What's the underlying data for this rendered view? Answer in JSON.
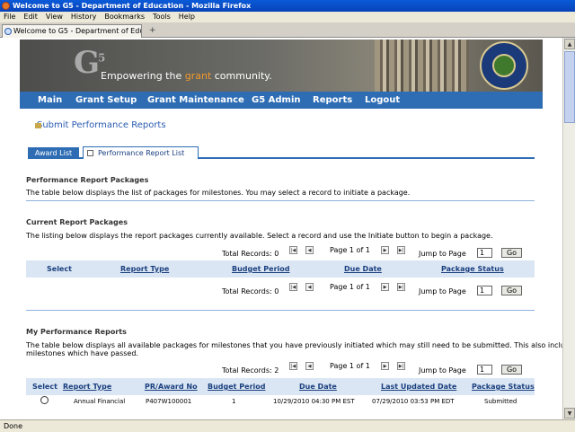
{
  "window": {
    "title": "Welcome to G5 - Department of Education - Mozilla Firefox"
  },
  "menu": [
    "File",
    "Edit",
    "View",
    "History",
    "Bookmarks",
    "Tools",
    "Help"
  ],
  "browser_tab": {
    "title": "Welcome to G5 - Department of Educ...",
    "new_tab": "+"
  },
  "status": "Done",
  "banner": {
    "logo": "G",
    "logo_sup": "5",
    "tagline_pre": "Empowering the ",
    "tagline_accent": "grant",
    "tagline_post": " community.",
    "accent": "#f39a2a"
  },
  "nav": [
    "Main",
    "Grant Setup",
    "Grant Maintenance",
    "G5 Admin",
    "Reports",
    "Logout"
  ],
  "page_title": "Submit Performance Reports",
  "tabs": {
    "award": "Award List",
    "perf": "Performance Report List"
  },
  "packages": {
    "title": "Performance Report Packages",
    "desc": "The table below displays the list of packages for milestones. You may select a record to initiate a package."
  },
  "current": {
    "title": "Current Report Packages",
    "desc": "The listing below displays the report packages currently available. Select a record and use the Initiate button to begin a package.",
    "total": "Total Records: 0",
    "page": "Page 1 of 1",
    "jump": "Jump to Page",
    "jump_value": "1",
    "go": "Go",
    "columns": [
      "Select",
      "Report Type",
      "Budget Period",
      "Due Date",
      "Package Status"
    ]
  },
  "mine": {
    "title": "My Performance Reports",
    "desc1": "The table below displays all available packages for milestones that you have previously initiated which may still need to be submitted. This also includes",
    "desc2": "milestones which have passed.",
    "total": "Total Records: 2",
    "page": "Page 1 of 1",
    "jump": "Jump to Page",
    "jump_value": "1",
    "go": "Go",
    "columns": [
      "Select",
      "Report Type",
      "PR/Award No",
      "Budget Period",
      "Due Date",
      "Last Updated Date",
      "Package Status"
    ],
    "rows": [
      {
        "report_type": "Annual Financial",
        "award_no": "P407W100001",
        "budget_period": "1",
        "due_date": "10/29/2010 04:30 PM EST",
        "updated": "07/29/2010 03:53 PM EDT",
        "status": "Submitted"
      }
    ]
  },
  "colors": {
    "nav": "#2e6db4",
    "header_bg": "#dbe6f4",
    "link": "#1a3f7e"
  }
}
